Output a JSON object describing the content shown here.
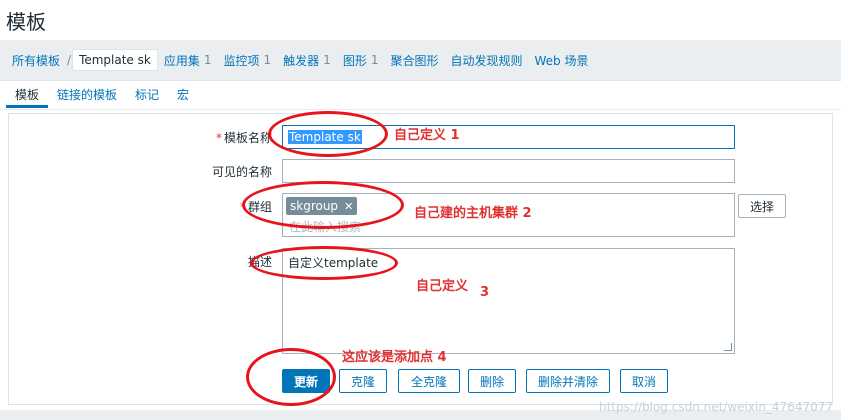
{
  "page": {
    "title": "模板"
  },
  "breadcrumb": [
    {
      "label": "所有模板",
      "count": "",
      "current": false
    },
    {
      "label": "Template sk",
      "count": "",
      "current": true
    },
    {
      "label": "应用集",
      "count": "1",
      "current": false
    },
    {
      "label": "监控项",
      "count": "1",
      "current": false
    },
    {
      "label": "触发器",
      "count": "1",
      "current": false
    },
    {
      "label": "图形",
      "count": "1",
      "current": false
    },
    {
      "label": "聚合图形",
      "count": "",
      "current": false
    },
    {
      "label": "自动发现规则",
      "count": "",
      "current": false
    },
    {
      "label": "Web 场景",
      "count": "",
      "current": false
    }
  ],
  "tabs": [
    "模板",
    "链接的模板",
    "标记",
    "宏"
  ],
  "form": {
    "template_name_label": "模板名称",
    "template_name_value": "Template sk",
    "visible_name_label": "可见的名称",
    "visible_name_value": "",
    "groups_label": "群组",
    "group_chip": "skgroup",
    "group_placeholder": "在此输入搜索",
    "select_button": "选择",
    "description_label": "描述",
    "description_value": "自定义template"
  },
  "buttons": {
    "update": "更新",
    "clone": "克隆",
    "full_clone": "全克隆",
    "delete": "删除",
    "delete_clear": "删除并清除",
    "cancel": "取消"
  },
  "annotations": {
    "a1": "自己定义 1",
    "a2": "自己建的主机集群  2",
    "a3_text": "自己定义",
    "a3_num": "3",
    "a4": "这应该是添加点   4"
  },
  "watermark": "https://blog.csdn.net/weixin_47647077",
  "colors": {
    "accent": "#0275b8",
    "annotation": "#e8141b"
  }
}
